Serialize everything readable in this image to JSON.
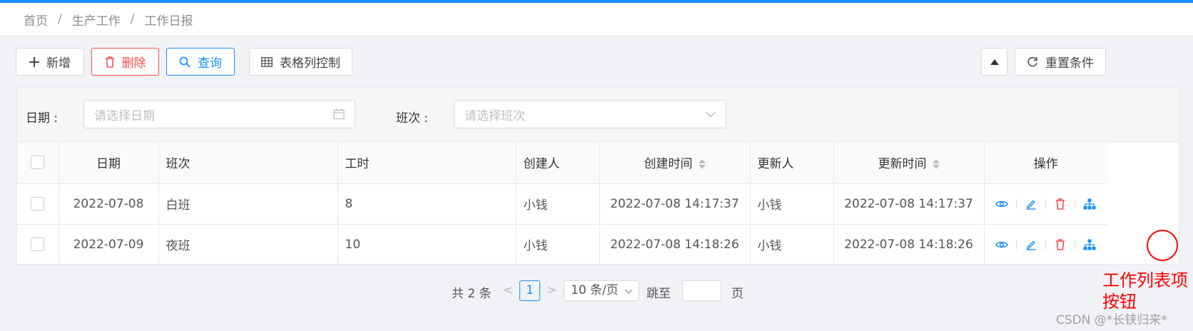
{
  "breadcrumb": [
    "首页",
    "生产工作",
    "工作日报"
  ],
  "toolbar": {
    "add_label": "新增",
    "delete_label": "删除",
    "query_label": "查询",
    "columns_label": "表格列控制",
    "reset_label": "重置条件"
  },
  "filters": {
    "date_label": "日期 :",
    "date_placeholder": "请选择日期",
    "shift_label": "班次 :",
    "shift_placeholder": "请选择班次"
  },
  "table": {
    "headers": [
      "日期",
      "班次",
      "工时",
      "创建人",
      "创建时间",
      "更新人",
      "更新时间",
      "操作"
    ],
    "rows": [
      [
        "2022-07-08",
        "白班",
        "8",
        "小钱",
        "2022-07-08 14:17:37",
        "小钱",
        "2022-07-08 14:17:37"
      ],
      [
        "2022-07-09",
        "夜班",
        "10",
        "小钱",
        "2022-07-08 14:18:26",
        "小钱",
        "2022-07-08 14:18:26"
      ]
    ]
  },
  "pagination": {
    "total": "共 2 条",
    "current_page": "1",
    "page_size": "10 条/页",
    "jump_label": "跳至",
    "page_suffix": "页"
  },
  "annotation": {
    "label": "工作列表项按钮"
  },
  "watermark": "CSDN @*长铗归来*",
  "colors": {
    "primary": "#1890ff",
    "danger": "#ff4d4f",
    "annotation": "#ff0000"
  }
}
